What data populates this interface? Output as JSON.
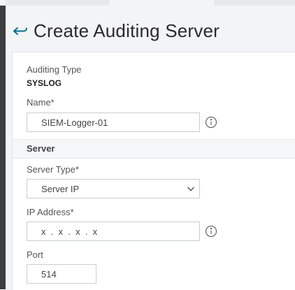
{
  "page": {
    "title": "Create Auditing Server"
  },
  "form": {
    "auditing_type_label": "Auditing Type",
    "auditing_type_value": "SYSLOG",
    "name_label": "Name*",
    "name_value": "SIEM-Logger-01",
    "section_server": "Server",
    "server_type_label": "Server Type*",
    "server_type_value": "Server IP",
    "ip_label": "IP Address*",
    "ip_value": "x  .  x  .  x  .  x",
    "port_label": "Port",
    "port_value": "514"
  },
  "icons": {
    "back": "back-arrow-icon",
    "info": "info-icon",
    "dropdown": "chevron-down-icon"
  },
  "colors": {
    "accent": "#0a6e8f",
    "panel_bg": "#ffffff",
    "page_bg": "#f2f4f6"
  }
}
